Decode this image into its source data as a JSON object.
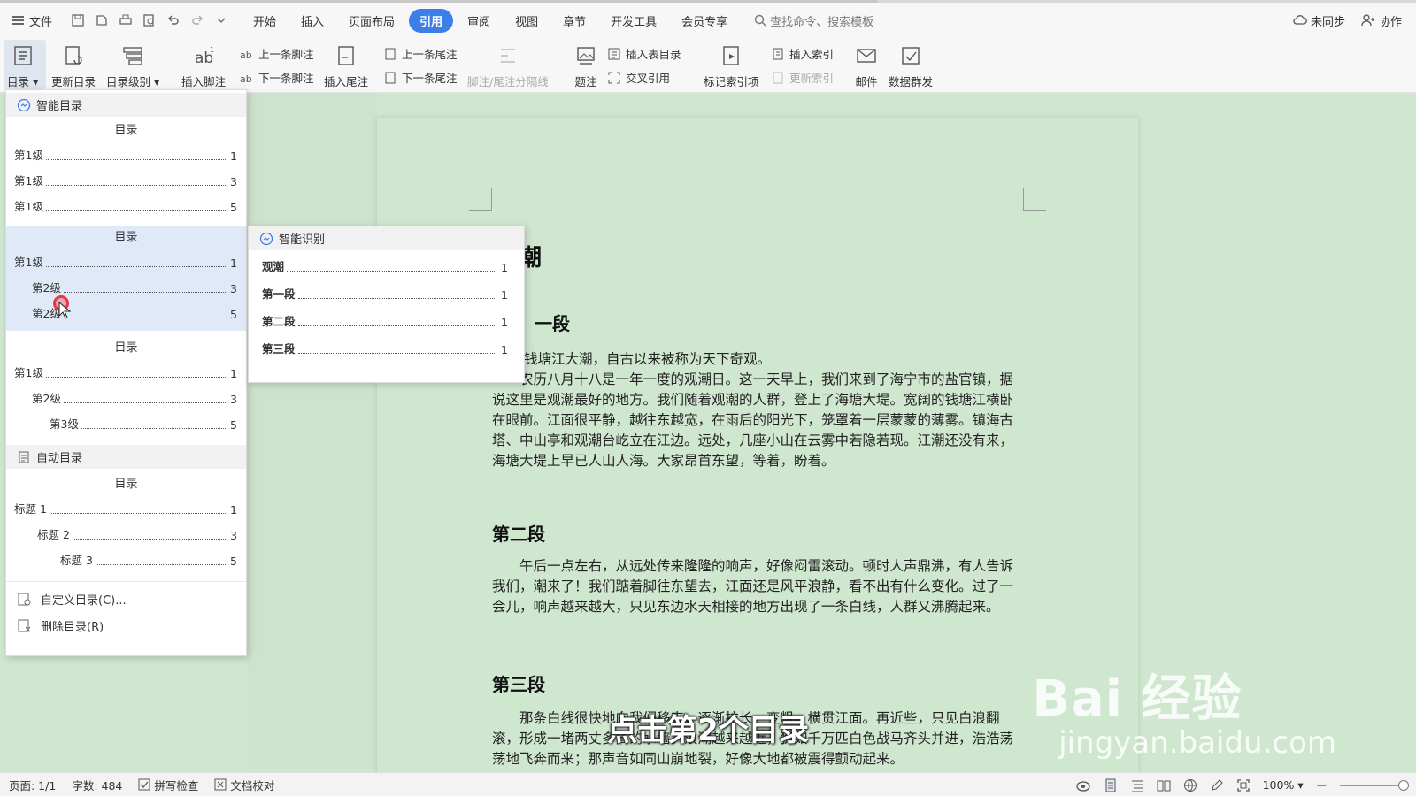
{
  "menubar": {
    "file_label": "文件",
    "tabs": [
      {
        "label": "开始"
      },
      {
        "label": "插入"
      },
      {
        "label": "页面布局"
      },
      {
        "label": "引用"
      },
      {
        "label": "审阅"
      },
      {
        "label": "视图"
      },
      {
        "label": "章节"
      },
      {
        "label": "开发工具"
      },
      {
        "label": "会员专享"
      }
    ],
    "active_tab": "引用",
    "search_placeholder": "查找命令、搜索模板",
    "sync_label": "未同步",
    "collab_label": "协作"
  },
  "ribbon": {
    "toc": "目录",
    "update_toc": "更新目录",
    "toc_level": "目录级别",
    "insert_footnote": "插入脚注",
    "prev_footnote": "上一条脚注",
    "next_footnote": "下一条脚注",
    "insert_endnote": "插入尾注",
    "prev_endnote": "上一条尾注",
    "next_endnote": "下一条尾注",
    "separator": "脚注/尾注分隔线",
    "caption": "题注",
    "insert_table_toc": "插入表目录",
    "cross_ref": "交叉引用",
    "mark_index": "标记索引项",
    "insert_index": "插入索引",
    "update_index": "更新索引",
    "mail": "邮件",
    "data_send": "数据群发"
  },
  "dropdown": {
    "smart_header": "智能目录",
    "blocks": [
      {
        "title": "目录",
        "lines": [
          {
            "text": "第1级",
            "page": "1"
          },
          {
            "text": "第1级",
            "page": "3"
          },
          {
            "text": "第1级",
            "page": "5"
          }
        ]
      },
      {
        "title": "目录",
        "lines": [
          {
            "text": "第1级",
            "page": "1"
          },
          {
            "text": "第2级",
            "page": "3"
          },
          {
            "text": "第2级",
            "page": "5"
          }
        ]
      },
      {
        "title": "目录",
        "lines": [
          {
            "text": "第1级",
            "page": "1"
          },
          {
            "text": "第2级",
            "page": "3"
          },
          {
            "text": "第3级",
            "page": "5"
          }
        ]
      }
    ],
    "auto_header": "自动目录",
    "auto_block": {
      "title": "目录",
      "lines": [
        {
          "text": "标题 1",
          "page": "1"
        },
        {
          "text": "标题 2",
          "page": "3"
        },
        {
          "text": "标题 3",
          "page": "5"
        }
      ]
    },
    "custom_toc": "自定义目录(C)...",
    "delete_toc": "删除目录(R)"
  },
  "submenu": {
    "header": "智能识别",
    "lines": [
      {
        "text": "观潮",
        "page": "1"
      },
      {
        "text": "第一段",
        "page": "1"
      },
      {
        "text": "第二段",
        "page": "1"
      },
      {
        "text": "第三段",
        "page": "1"
      }
    ]
  },
  "document": {
    "title_fragment": "潮",
    "h_first_fragment": "一段",
    "p1": "钱塘江大潮，自古以来被称为天下奇观。",
    "p2": "农历八月十八是一年一度的观潮日。这一天早上，我们来到了海宁市的盐官镇，据说这里是观潮最好的地方。我们随着观潮的人群，登上了海塘大堤。宽阔的钱塘江横卧在眼前。江面很平静，越往东越宽，在雨后的阳光下，笼罩着一层蒙蒙的薄雾。镇海古塔、中山亭和观潮台屹立在江边。远处，几座小山在云雾中若隐若现。江潮还没有来，海塘大堤上早已人山人海。大家昂首东望，等着，盼着。",
    "h2": "第二段",
    "p3": "午后一点左右，从远处传来隆隆的响声，好像闷雷滚动。顿时人声鼎沸，有人告诉我们，潮来了！我们踮着脚往东望去，江面还是风平浪静，看不出有什么变化。过了一会儿，响声越来越大，只见东边水天相接的地方出现了一条白线，人群又沸腾起来。",
    "h3": "第三段",
    "p4": "那条白线很快地向我们移来，逐渐拉长，变粗，横贯江面。再近些，只见白浪翻滚，形成一堵两丈多高的水墙。浪潮越来越近，犹如千万匹白色战马齐头并进，浩浩荡荡地飞奔而来；那声音如同山崩地裂，好像大地都被震得颤动起来。"
  },
  "status": {
    "page": "页面: 1/1",
    "words": "字数: 484",
    "spell": "拼写检查",
    "proof": "文档校对",
    "zoom": "100%"
  },
  "overlay": {
    "caption": "点击第2个目录",
    "watermark_brand": "Bai  经验",
    "watermark_url": "jingyan.baidu.com"
  },
  "colors": {
    "accent": "#3d7fe8",
    "doc_background": "#cfe6cf",
    "highlight": "#dfe9f8"
  }
}
